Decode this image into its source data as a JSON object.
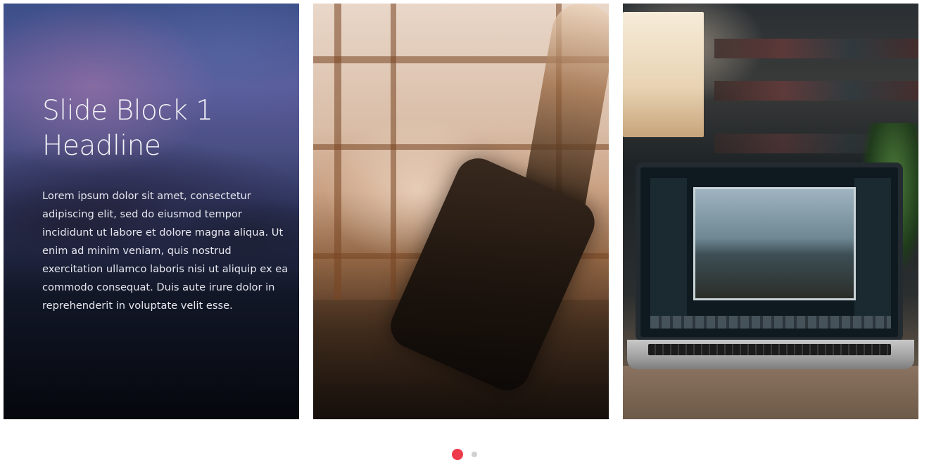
{
  "slides": [
    {
      "headline": "Slide Block 1 Headline",
      "body": "Lorem ipsum dolor sit amet, consectetur adipiscing elit, sed do eiusmod tempor incididunt ut labore et dolore magna aliqua. Ut enim ad minim veniam, quis nostrud exercitation ullamco laboris nisi ut aliquip ex ea commodo consequat. Duis aute irure dolor in reprehenderit in voluptate velit esse."
    }
  ],
  "pagination": {
    "active_color": "#ee3a4a",
    "inactive_color": "#d0d0d0"
  }
}
